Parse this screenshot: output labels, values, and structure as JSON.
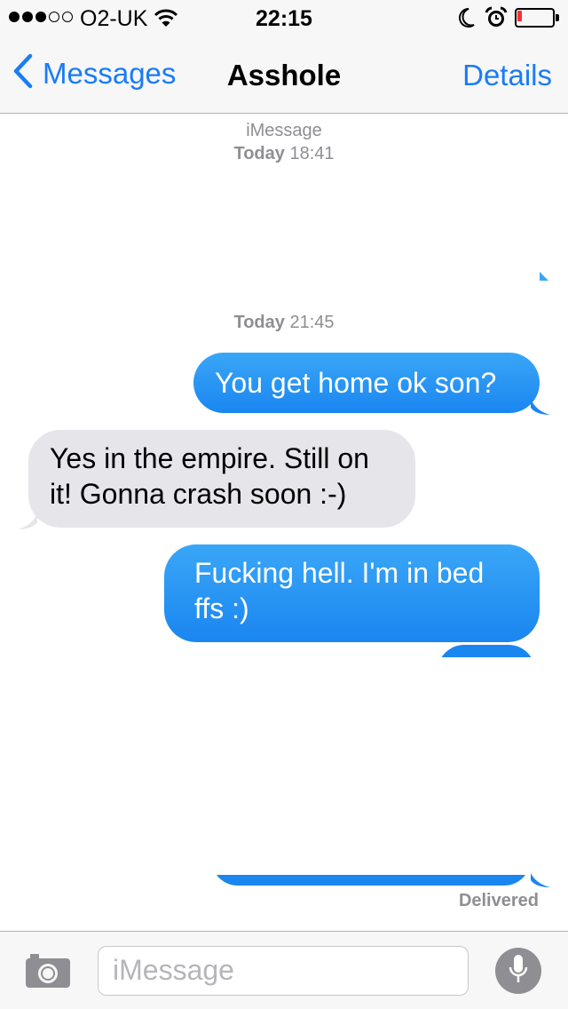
{
  "status_bar": {
    "carrier": "O2-UK",
    "time": "22:15",
    "signal_bars_filled": 3,
    "signal_bars_total": 5,
    "battery_level": 0.12,
    "battery_color": "#ff2d2d",
    "icons": [
      "wifi-icon",
      "moon-icon",
      "alarm-icon",
      "battery-icon"
    ]
  },
  "nav": {
    "back_label": "Messages",
    "title": "Asshole",
    "details_label": "Details",
    "accent_color": "#1a7cf5"
  },
  "conversation": {
    "header_service": "iMessage",
    "first_timestamp_day": "Today",
    "first_timestamp_time": "18:41",
    "second_timestamp_day": "Today",
    "second_timestamp_time": "21:45",
    "messages": [
      {
        "direction": "sent",
        "text": "You get home ok son?"
      },
      {
        "direction": "received",
        "text": "Yes in the empire. Still on it! Gonna crash soon :-)"
      },
      {
        "direction": "sent",
        "text": "Fucking hell. I'm in bed ffs :)"
      }
    ],
    "delivered_label": "Delivered",
    "sent_color": "#1a86f0",
    "received_color": "#e5e5ea"
  },
  "input_bar": {
    "placeholder": "iMessage",
    "icons": [
      "camera-icon",
      "microphone-icon"
    ]
  }
}
